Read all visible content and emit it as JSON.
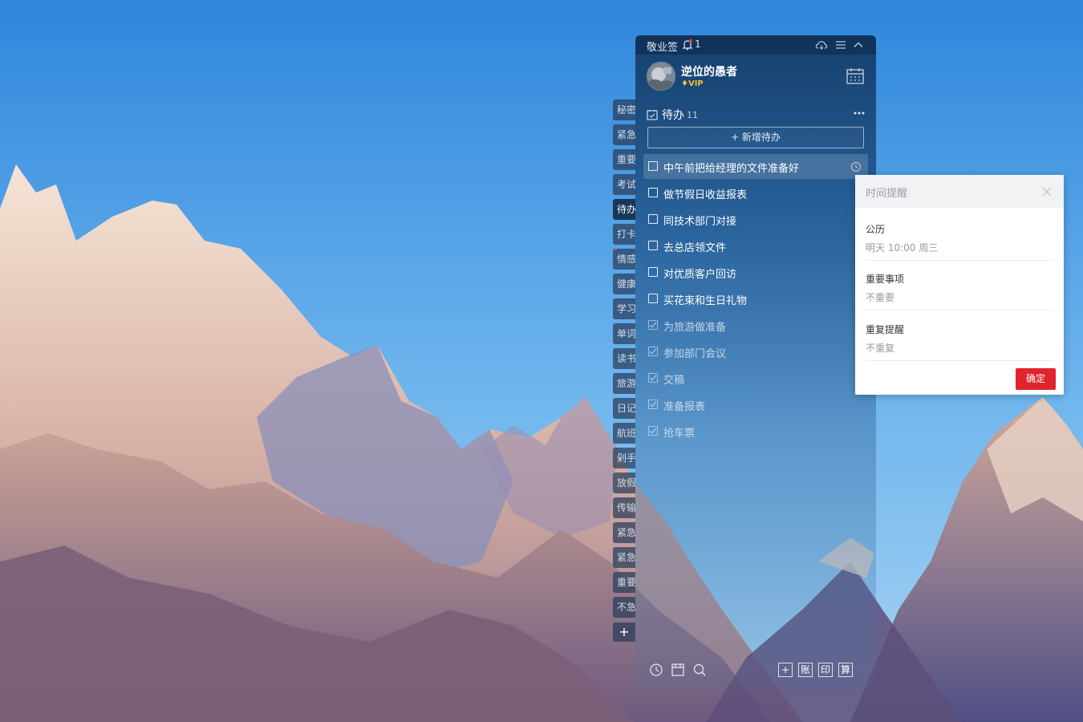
{
  "app": {
    "name": "敬业签",
    "notification_count": "1"
  },
  "user": {
    "name": "逆位的愚者",
    "badge": "VIP"
  },
  "side_tabs": [
    "秘密",
    "紧急",
    "重要",
    "考试",
    "待办",
    "打卡",
    "情感",
    "健康",
    "学习",
    "单词",
    "读书",
    "旅游",
    "日记",
    "航班",
    "剁手",
    "放假",
    "传输",
    "紧急",
    "紧急",
    "重要",
    "不急"
  ],
  "side_tab_add": "+",
  "todo_section": {
    "title": "待办",
    "count": "11",
    "add_label": "+ 新增待办"
  },
  "todos": [
    {
      "text": "中午前把给经理的文件准备好",
      "done": false
    },
    {
      "text": "做节假日收益报表",
      "done": false
    },
    {
      "text": "同技术部门对接",
      "done": false
    },
    {
      "text": "去总店领文件",
      "done": false
    },
    {
      "text": "对优质客户回访",
      "done": false
    },
    {
      "text": "买花束和生日礼物",
      "done": false
    },
    {
      "text": "为旅游做准备",
      "done": true
    },
    {
      "text": "参加部门会议",
      "done": true
    },
    {
      "text": "交稿",
      "done": true
    },
    {
      "text": "准备报表",
      "done": true
    },
    {
      "text": "抢车票",
      "done": true
    }
  ],
  "bottom_bar": {
    "buttons": [
      "+",
      "账",
      "印",
      "算"
    ]
  },
  "reminder_popup": {
    "title": "时间提醒",
    "rows": [
      {
        "label": "公历",
        "value": "明天 10:00 周三"
      },
      {
        "label": "重要事项",
        "value": "不重要"
      },
      {
        "label": "重复提醒",
        "value": "不重复"
      }
    ],
    "confirm_label": "确定"
  },
  "colors": {
    "accent_red": "#e0242c",
    "vip_gold": "#f3c12d",
    "panel_bg": "#153c68"
  }
}
